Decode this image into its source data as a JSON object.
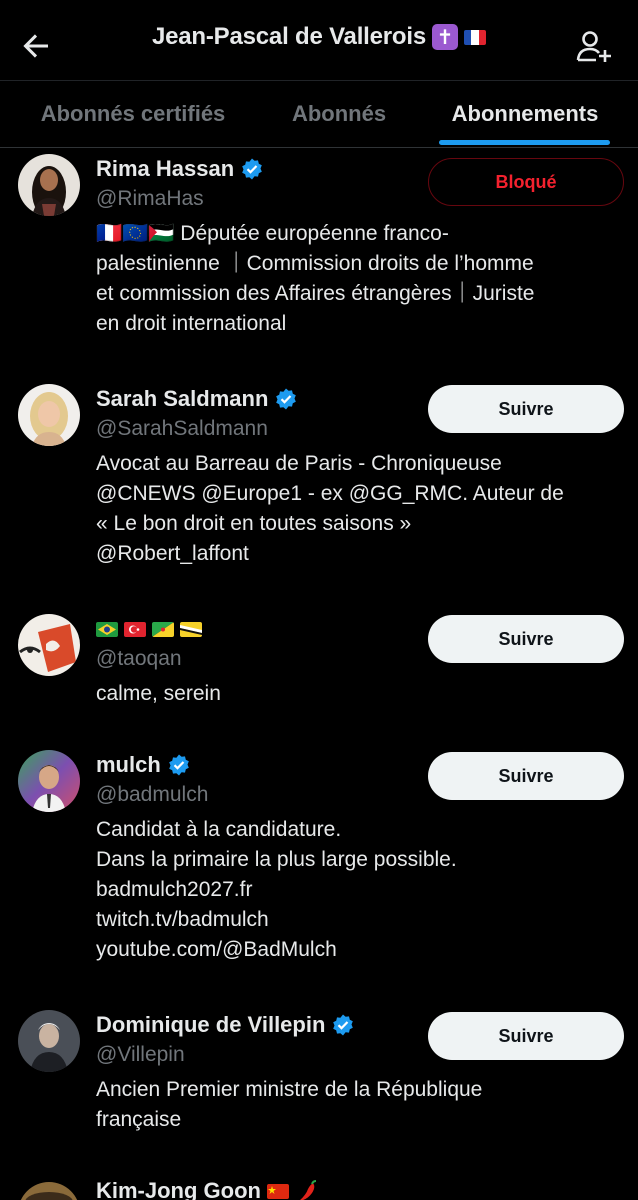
{
  "header": {
    "title": "Jean-Pascal de Vallerois",
    "title_emoji": "✝",
    "back_label": "←"
  },
  "tabs": [
    {
      "label": "Abonnés certifiés"
    },
    {
      "label": "Abonnés"
    },
    {
      "label": "Abonnements",
      "active": true
    }
  ],
  "users": [
    {
      "name": "Rima Hassan",
      "handle": "@RimaHas",
      "verified": true,
      "button": "Bloqué",
      "bio": "🇫🇷🇪🇺🇵🇸 Députée européenne franco-\npalestinienne ｜Commission droits de l’homme\net commission des Affaires étrangères｜Juriste\nen droit international"
    },
    {
      "name": "Sarah Saldmann",
      "handle": "@SarahSaldmann",
      "verified": true,
      "button": "Suivre",
      "bio": "Avocat au Barreau de Paris - Chroniqueuse\n@CNEWS @Europe1 - ex @GG_RMC. Auteur de\n« Le bon droit en toutes saisons »\n@Robert_laffont"
    },
    {
      "name": "🇧🇷🇹🇷🇬🇫🇧🇳",
      "handle": "@taoqan",
      "verified": false,
      "button": "Suivre",
      "bio": "calme, serein"
    },
    {
      "name": "mulch",
      "handle": "@badmulch",
      "verified": true,
      "button": "Suivre",
      "bio": "Candidat à la candidature.\nDans la primaire la plus large possible.\nbadmulch2027.fr\ntwitch.tv/badmulch\nyoutube.com/@BadMulch"
    },
    {
      "name": "Dominique de Villepin",
      "handle": "@Villepin",
      "verified": true,
      "button": "Suivre",
      "bio": "Ancien Premier ministre de la République\nfrançaise"
    },
    {
      "name": "Kim-Jong Goon",
      "name_emoji": "🇨🇳🌶",
      "handle": "",
      "verified": false,
      "button": "",
      "bio": ""
    }
  ],
  "colors": {
    "accent": "#1d9bf0",
    "verified": "#1d9bf0",
    "blocked": "#f4212e",
    "background": "#000000",
    "muted": "#71767b"
  },
  "icons": {
    "back": "arrow-left-icon",
    "add_user": "add-user-icon",
    "verified": "verified-badge-icon"
  }
}
